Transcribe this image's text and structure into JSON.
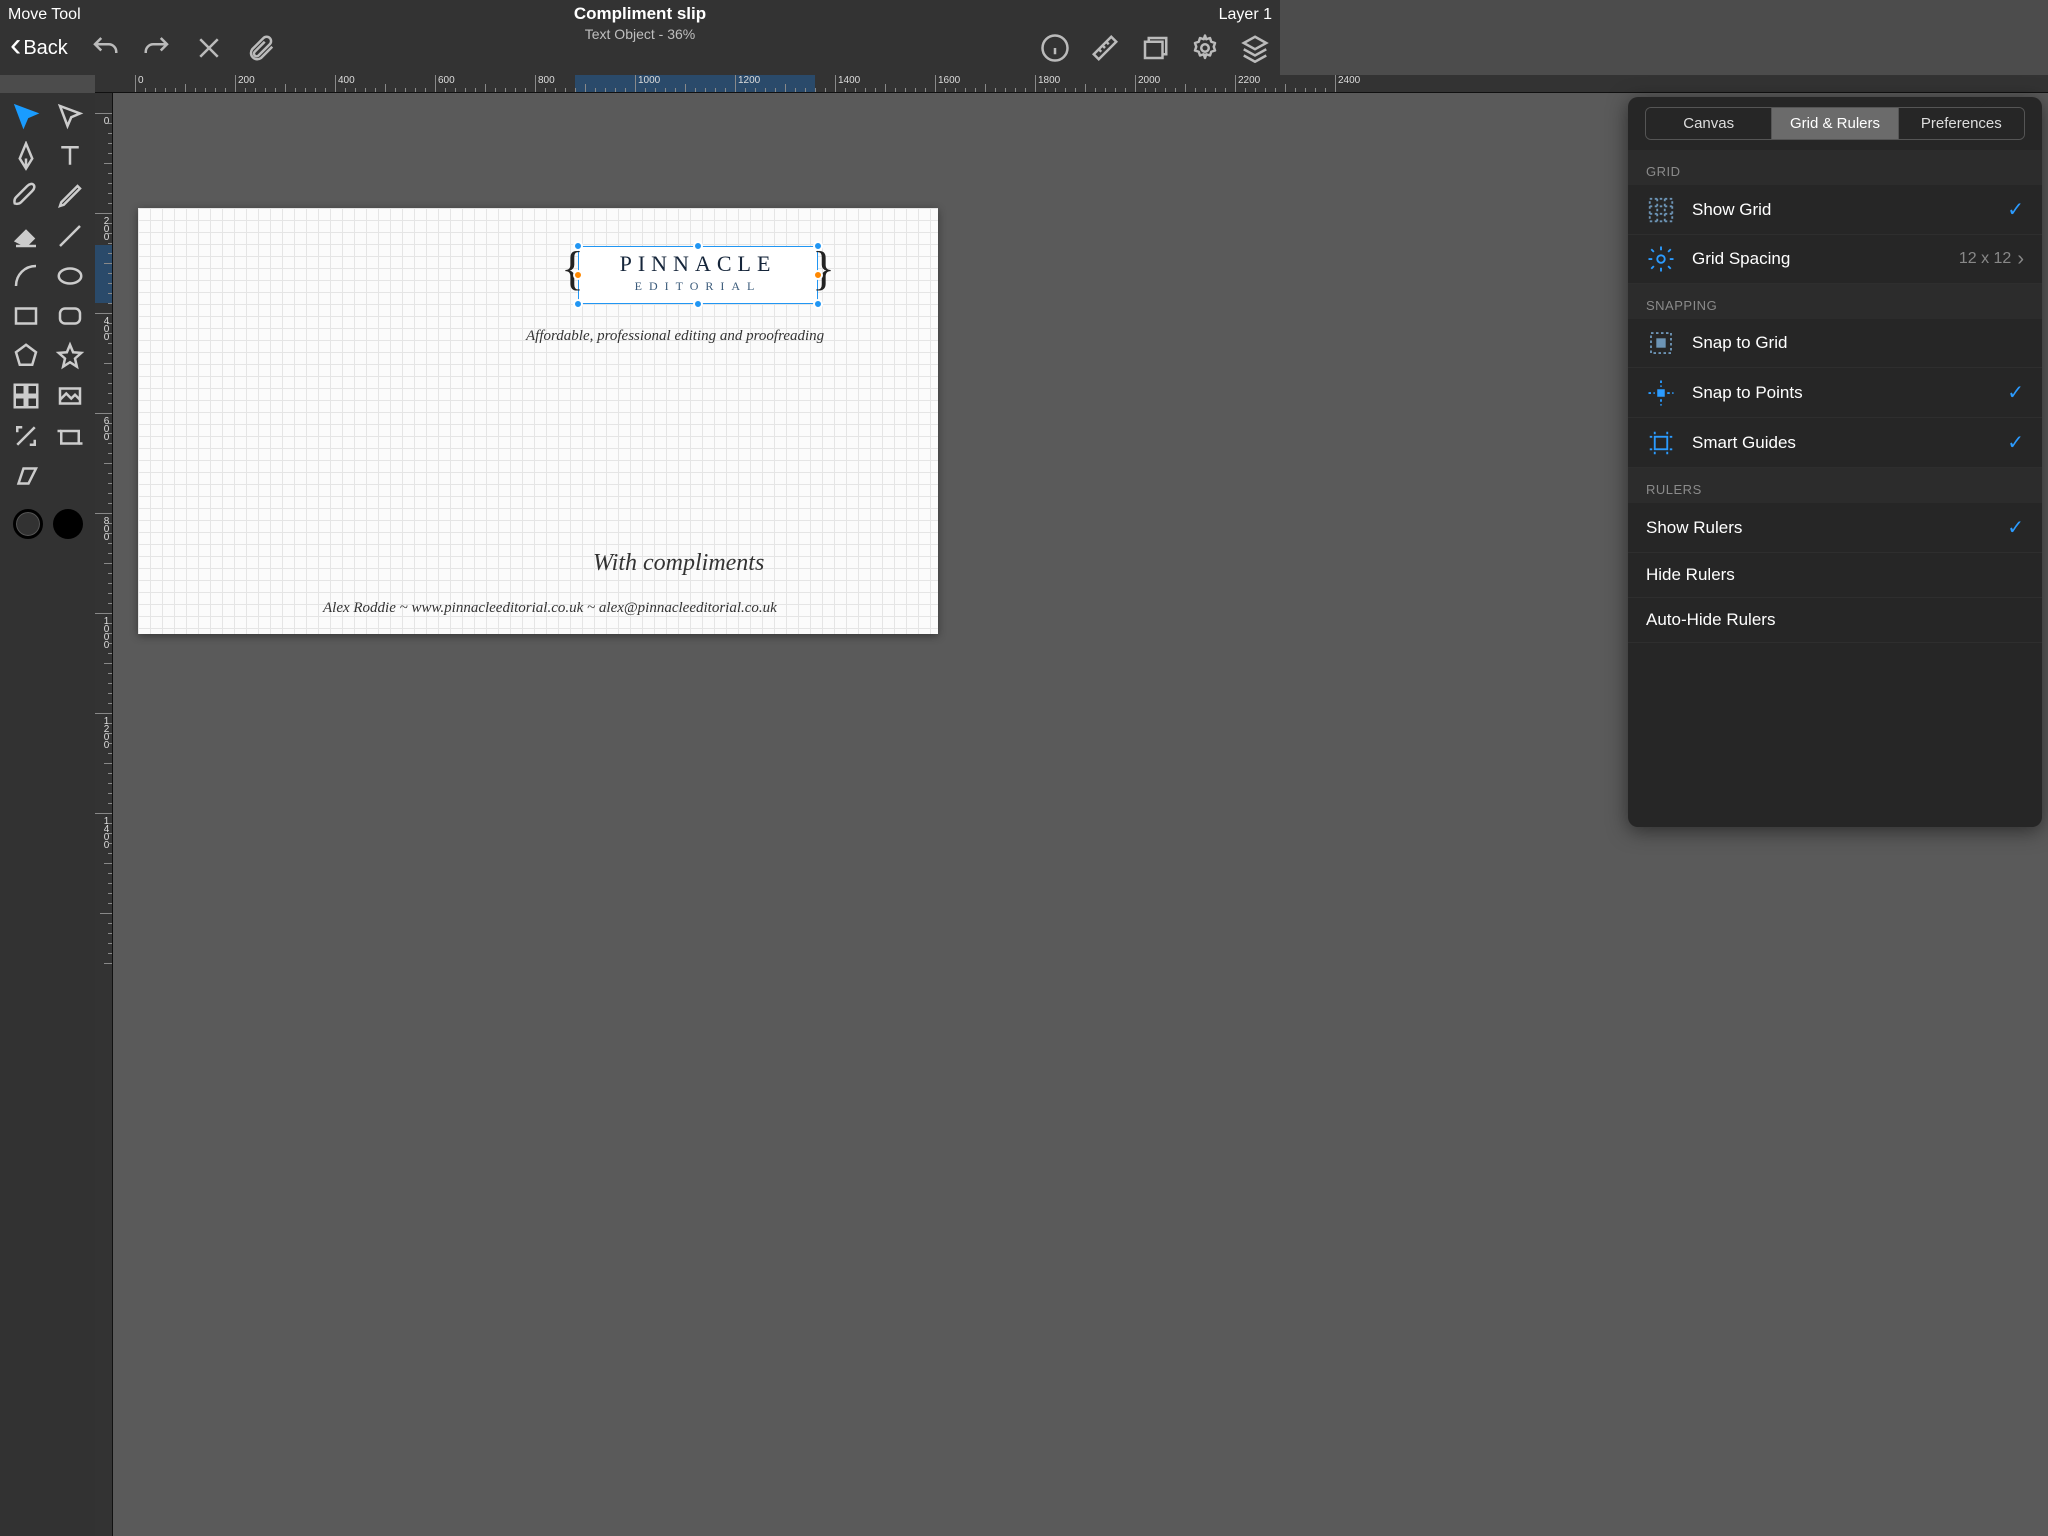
{
  "topbar": {
    "tool": "Move Tool",
    "title": "Compliment slip",
    "subtitle": "Text Object - 36%",
    "layer": "Layer 1",
    "back": "Back"
  },
  "ruler_h": [
    0,
    200,
    400,
    600,
    800,
    1000,
    1200,
    1400,
    1600,
    1800,
    2000,
    2200,
    2400
  ],
  "ruler_v": [
    0,
    200,
    400,
    600,
    800,
    1000,
    1200,
    1400
  ],
  "canvas": {
    "logo_line1": "PINNACLE",
    "logo_line2": "EDITORIAL",
    "tagline": "Affordable, professional editing and proofreading",
    "compliments": "With compliments",
    "footer": "Alex Roddie   ~   www.pinnacleeditorial.co.uk   ~   alex@pinnacleeditorial.co.uk"
  },
  "panel": {
    "tabs": [
      "Canvas",
      "Grid & Rulers",
      "Preferences"
    ],
    "active_tab": 1,
    "sections": {
      "grid_label": "GRID",
      "show_grid": "Show Grid",
      "grid_spacing": "Grid Spacing",
      "grid_spacing_value": "12 x 12",
      "snapping_label": "SNAPPING",
      "snap_to_grid": "Snap to Grid",
      "snap_to_points": "Snap to Points",
      "smart_guides": "Smart Guides",
      "rulers_label": "RULERS",
      "show_rulers": "Show Rulers",
      "hide_rulers": "Hide Rulers",
      "auto_hide_rulers": "Auto-Hide Rulers"
    }
  }
}
